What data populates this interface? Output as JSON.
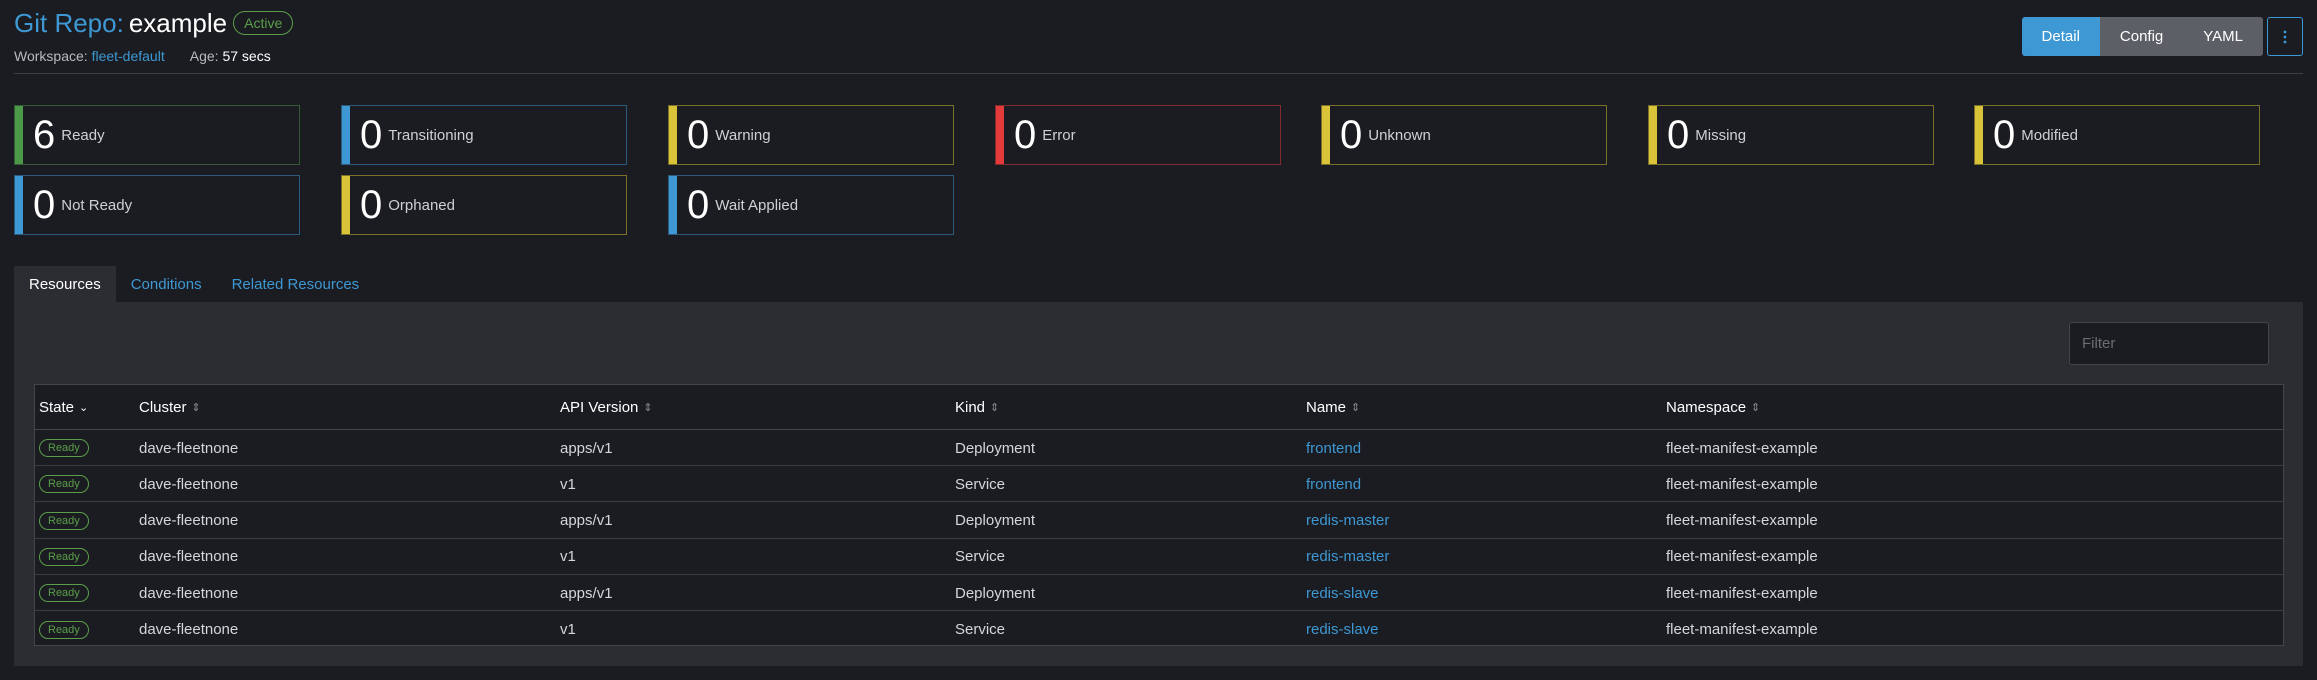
{
  "header": {
    "title_prefix": "Git Repo:",
    "title_name": "example",
    "state": "Active",
    "workspace_label": "Workspace:",
    "workspace_value": "fleet-default",
    "age_label": "Age:",
    "age_value": "57 secs",
    "view_buttons": [
      "Detail",
      "Config",
      "YAML"
    ],
    "active_view": "Detail",
    "more_icon": "more-vertical-icon"
  },
  "tiles": [
    {
      "count": "6",
      "label": "Ready",
      "color": "#4c9a47"
    },
    {
      "count": "0",
      "label": "Transitioning",
      "color": "#3d98d3"
    },
    {
      "count": "0",
      "label": "Warning",
      "color": "#d9c338"
    },
    {
      "count": "0",
      "label": "Error",
      "color": "#e53a3a"
    },
    {
      "count": "0",
      "label": "Unknown",
      "color": "#d9c338"
    },
    {
      "count": "0",
      "label": "Missing",
      "color": "#d9c338"
    },
    {
      "count": "0",
      "label": "Modified",
      "color": "#d9c338"
    },
    {
      "count": "0",
      "label": "Not Ready",
      "color": "#3d98d3"
    },
    {
      "count": "0",
      "label": "Orphaned",
      "color": "#d9c338"
    },
    {
      "count": "0",
      "label": "Wait Applied",
      "color": "#3d98d3"
    }
  ],
  "tabs": [
    "Resources",
    "Conditions",
    "Related Resources"
  ],
  "active_tab": "Resources",
  "filter": {
    "placeholder": "Filter"
  },
  "table": {
    "columns": [
      "State",
      "Cluster",
      "API Version",
      "Kind",
      "Name",
      "Namespace"
    ],
    "rows": [
      {
        "state": "Ready",
        "cluster": "dave-fleetnone",
        "api_version": "apps/v1",
        "kind": "Deployment",
        "name": "frontend",
        "namespace": "fleet-manifest-example"
      },
      {
        "state": "Ready",
        "cluster": "dave-fleetnone",
        "api_version": "v1",
        "kind": "Service",
        "name": "frontend",
        "namespace": "fleet-manifest-example"
      },
      {
        "state": "Ready",
        "cluster": "dave-fleetnone",
        "api_version": "apps/v1",
        "kind": "Deployment",
        "name": "redis-master",
        "namespace": "fleet-manifest-example"
      },
      {
        "state": "Ready",
        "cluster": "dave-fleetnone",
        "api_version": "v1",
        "kind": "Service",
        "name": "redis-master",
        "namespace": "fleet-manifest-example"
      },
      {
        "state": "Ready",
        "cluster": "dave-fleetnone",
        "api_version": "apps/v1",
        "kind": "Deployment",
        "name": "redis-slave",
        "namespace": "fleet-manifest-example"
      },
      {
        "state": "Ready",
        "cluster": "dave-fleetnone",
        "api_version": "v1",
        "kind": "Service",
        "name": "redis-slave",
        "namespace": "fleet-manifest-example"
      }
    ]
  }
}
